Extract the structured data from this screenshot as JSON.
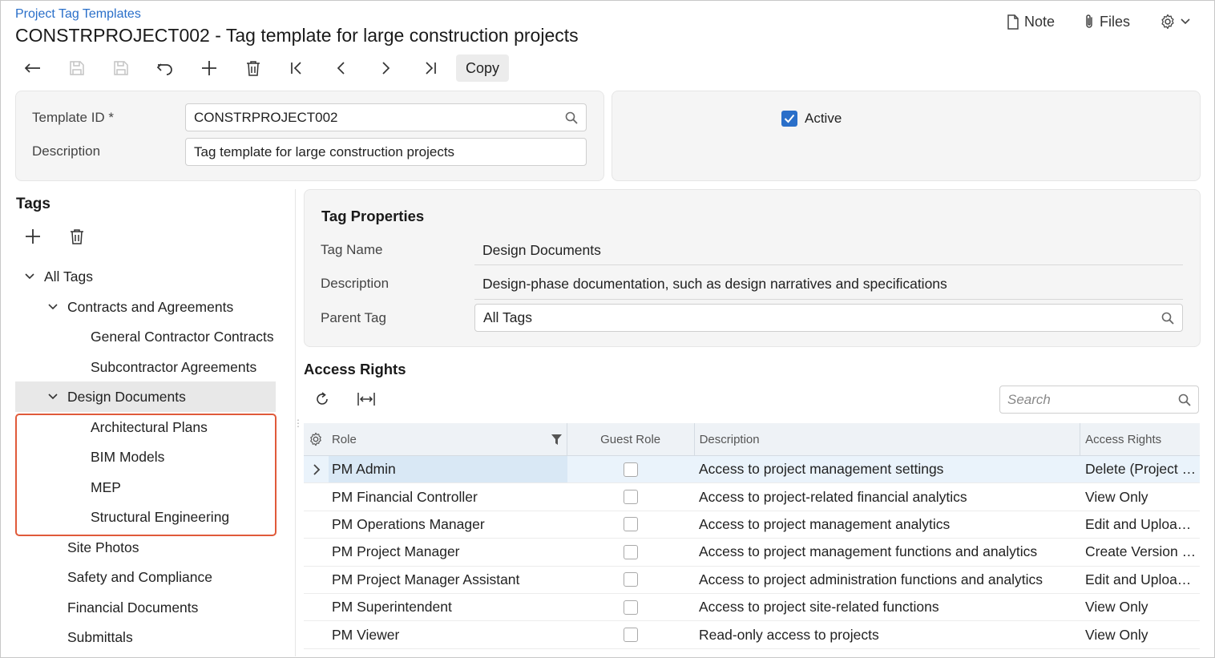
{
  "header": {
    "breadcrumb": "Project Tag Templates",
    "title": "CONSTRPROJECT002 - Tag template for large construction projects",
    "note_label": "Note",
    "files_label": "Files"
  },
  "toolbar": {
    "copy_label": "Copy",
    "icons": [
      "back-icon",
      "save-close-icon",
      "save-icon",
      "undo-icon",
      "add-icon",
      "delete-icon",
      "first-record-icon",
      "previous-record-icon",
      "next-record-icon",
      "last-record-icon"
    ]
  },
  "summary": {
    "template_id_label": "Template ID *",
    "template_id_value": "CONSTRPROJECT002",
    "description_label": "Description",
    "description_value": "Tag template for large construction projects",
    "active_label": "Active",
    "active_checked": true
  },
  "tags": {
    "heading": "Tags",
    "tree": [
      {
        "label": "All Tags",
        "level": 0,
        "expanded": true
      },
      {
        "label": "Contracts and Agreements",
        "level": 1,
        "expanded": true
      },
      {
        "label": "General Contractor Contracts",
        "level": 2
      },
      {
        "label": "Subcontractor Agreements",
        "level": 2
      },
      {
        "label": "Design Documents",
        "level": 1,
        "expanded": true,
        "selected": true
      },
      {
        "label": "Architectural Plans",
        "level": 2
      },
      {
        "label": "BIM Models",
        "level": 2
      },
      {
        "label": "MEP",
        "level": 2
      },
      {
        "label": "Structural Engineering",
        "level": 2
      },
      {
        "label": "Site Photos",
        "level": 1
      },
      {
        "label": "Safety and Compliance",
        "level": 1
      },
      {
        "label": "Financial Documents",
        "level": 1
      },
      {
        "label": "Submittals",
        "level": 1
      }
    ]
  },
  "tag_properties": {
    "heading": "Tag Properties",
    "tag_name_label": "Tag Name",
    "tag_name_value": "Design Documents",
    "description_label": "Description",
    "description_value": "Design-phase documentation, such as design narratives and specifications",
    "parent_tag_label": "Parent Tag",
    "parent_tag_value": "All Tags"
  },
  "access_rights": {
    "heading": "Access Rights",
    "search_placeholder": "Search",
    "columns": [
      "Role",
      "Guest Role",
      "Description",
      "Access Rights"
    ],
    "rows": [
      {
        "role": "PM Admin",
        "guest": false,
        "description": "Access to project management settings",
        "rights": "Delete (Project …"
      },
      {
        "role": "PM Financial Controller",
        "guest": false,
        "description": "Access to project-related financial analytics",
        "rights": "View Only"
      },
      {
        "role": "PM Operations Manager",
        "guest": false,
        "description": "Access to project management analytics",
        "rights": "Edit and Uploa…"
      },
      {
        "role": "PM Project Manager",
        "guest": false,
        "description": "Access to project management functions and analytics",
        "rights": "Create Version …"
      },
      {
        "role": "PM Project Manager Assistant",
        "guest": false,
        "description": "Access to project administration functions and analytics",
        "rights": "Edit and Uploa…"
      },
      {
        "role": "PM Superintendent",
        "guest": false,
        "description": "Access to project site-related functions",
        "rights": "View Only"
      },
      {
        "role": "PM Viewer",
        "guest": false,
        "description": "Read-only access to projects",
        "rights": "View Only"
      }
    ]
  },
  "colors": {
    "accent": "#2a6fc9",
    "highlight_border": "#e05a3a",
    "selected_row": "#eaf3fb"
  }
}
